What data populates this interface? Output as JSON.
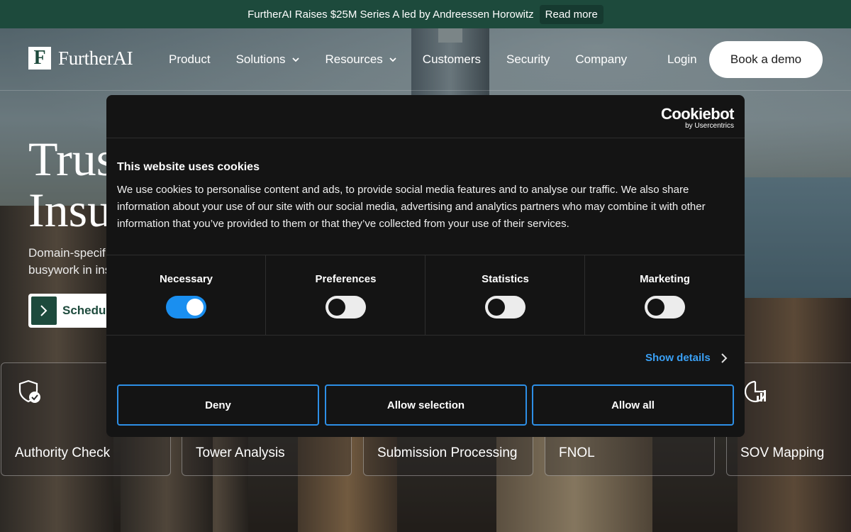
{
  "announcement": {
    "text": "FurtherAI Raises $25M Series A led by Andreessen Horowitz",
    "link_label": "Read more"
  },
  "nav": {
    "logo_mark": "F",
    "logo_text": "FurtherAI",
    "items": [
      {
        "label": "Product",
        "has_dropdown": false
      },
      {
        "label": "Solutions",
        "has_dropdown": true
      },
      {
        "label": "Resources",
        "has_dropdown": true
      },
      {
        "label": "Customers",
        "has_dropdown": false
      },
      {
        "label": "Security",
        "has_dropdown": false
      },
      {
        "label": "Company",
        "has_dropdown": false
      }
    ],
    "login_label": "Login",
    "cta_label": "Book a demo"
  },
  "hero": {
    "title_line1": "Trus",
    "title_line2": "Insu",
    "subtitle_line1": "Domain-specif",
    "subtitle_line2": "busywork in ins",
    "cta_label": "Schedule"
  },
  "cards": [
    {
      "title": "Authority Check",
      "icon": "shield-check-icon"
    },
    {
      "title": "Tower Analysis",
      "icon": ""
    },
    {
      "title": "Submission Processing",
      "icon": ""
    },
    {
      "title": "FNOL",
      "icon": ""
    },
    {
      "title": "SOV Mapping",
      "icon": "chart-gauge-icon"
    }
  ],
  "cookie_dialog": {
    "brand": "Cookiebot",
    "brand_sub": "by Usercentrics",
    "title": "This website uses cookies",
    "body": "We use cookies to personalise content and ads, to provide social media features and to analyse our traffic. We also share information about your use of our site with our social media, advertising and analytics partners who may combine it with other information that you’ve provided to them or that they’ve collected from your use of their services.",
    "categories": [
      {
        "label": "Necessary",
        "enabled": true
      },
      {
        "label": "Preferences",
        "enabled": false
      },
      {
        "label": "Statistics",
        "enabled": false
      },
      {
        "label": "Marketing",
        "enabled": false
      }
    ],
    "show_details_label": "Show details",
    "deny_label": "Deny",
    "allow_selection_label": "Allow selection",
    "allow_all_label": "Allow all",
    "accent_color": "#1a8ff0"
  }
}
